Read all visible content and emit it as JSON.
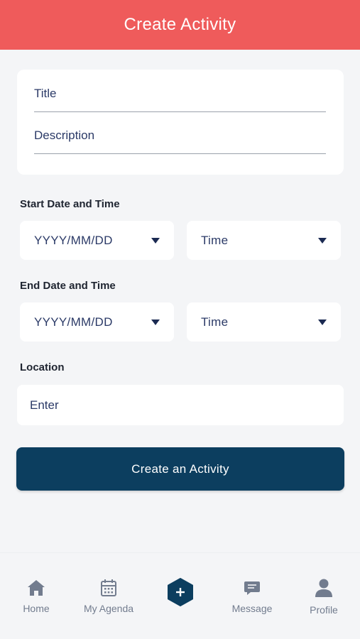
{
  "header": {
    "title": "Create Activity"
  },
  "details": {
    "title_placeholder": "Title",
    "description_placeholder": "Description"
  },
  "start": {
    "label": "Start Date and Time",
    "date_placeholder": "YYYY/MM/DD",
    "time_placeholder": "Time"
  },
  "end": {
    "label": "End Date and Time",
    "date_placeholder": "YYYY/MM/DD",
    "time_placeholder": "Time"
  },
  "location": {
    "label": "Location",
    "placeholder": "Enter"
  },
  "submit": {
    "label": "Create an Activity"
  },
  "tabbar": {
    "items": [
      {
        "label": "Home",
        "icon": "home-icon"
      },
      {
        "label": "My Agenda",
        "icon": "calendar-icon"
      },
      {
        "label": "",
        "icon": "plus-icon"
      },
      {
        "label": "Message",
        "icon": "message-icon"
      },
      {
        "label": "Profile",
        "icon": "user-icon"
      }
    ]
  },
  "colors": {
    "header": "#ef5b5b",
    "primary": "#0c3e5f",
    "background": "#f4f5f7",
    "icon": "#727c8e"
  }
}
